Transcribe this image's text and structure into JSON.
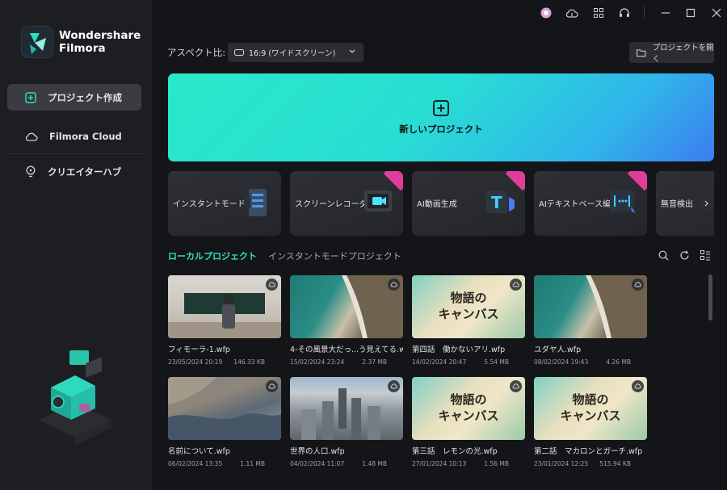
{
  "app": {
    "brand_line1": "Wondershare",
    "brand_line2": "Filmora"
  },
  "sidebar": {
    "items": [
      {
        "label": "プロジェクト作成",
        "icon": "new-project-icon",
        "active": true
      },
      {
        "label": "Filmora Cloud",
        "icon": "cloud-icon",
        "active": false
      },
      {
        "label": "クリエイターハブ",
        "icon": "lightbulb-icon",
        "active": false
      }
    ]
  },
  "topbar": {
    "icons": [
      "avatar-icon",
      "cloud-upload-icon",
      "grid-apps-icon",
      "headset-icon",
      "minimize-icon",
      "maximize-icon",
      "close-icon"
    ]
  },
  "aspect": {
    "label": "アスペクト比:",
    "value": "16:9 (ワイドスクリーン)"
  },
  "open_project": {
    "label": "プロジェクトを開く"
  },
  "new_project": {
    "label": "新しいプロジェクト"
  },
  "tools": [
    {
      "label": "インスタントモード",
      "badge": false
    },
    {
      "label": "スクリーンレコーダー",
      "badge": true
    },
    {
      "label": "AI動画生成",
      "badge": true
    },
    {
      "label": "AIテキストベース編集",
      "badge": true
    },
    {
      "label": "無音検出",
      "badge": false
    }
  ],
  "tabs": [
    {
      "label": "ローカルプロジェクト",
      "active": true
    },
    {
      "label": "インスタントモードプロジェクト",
      "active": false
    }
  ],
  "projects": [
    {
      "name": "フィモーラ-1.wfp",
      "date": "23/05/2024 20:19",
      "size": "146.33 KB",
      "thumb": "classroom"
    },
    {
      "name": "4-その風景大だっ...う見えてる.wfp",
      "date": "15/02/2024 23:24",
      "size": "2.37 MB",
      "thumb": "coast"
    },
    {
      "name": "第四話　働かないアリ.wfp",
      "date": "14/02/2024 20:47",
      "size": "5.54 MB",
      "thumb": "canvas"
    },
    {
      "name": "ユダヤ人.wfp",
      "date": "08/02/2024 19:43",
      "size": "4.26 MB",
      "thumb": "coast"
    },
    {
      "name": "名前について.wfp",
      "date": "06/02/2024 13:35",
      "size": "1.11 MB",
      "thumb": "canyon"
    },
    {
      "name": "世界の人口.wfp",
      "date": "04/02/2024 11:07",
      "size": "1.48 MB",
      "thumb": "city"
    },
    {
      "name": "第三話　レモンの光.wfp",
      "date": "27/01/2024 10:13",
      "size": "1.56 MB",
      "thumb": "canvas"
    },
    {
      "name": "第二話　マカロンとガーチ.wfp",
      "date": "23/01/2024 12:25",
      "size": "515.94 KB",
      "thumb": "canvas"
    }
  ],
  "canvas_title": {
    "line1": "物語の",
    "line2": "キャンバス"
  },
  "colors": {
    "accent": "#2fe0c5",
    "badge": "#e23c9a",
    "sidebar_bg": "#1d1e22",
    "main_bg": "#141518"
  }
}
